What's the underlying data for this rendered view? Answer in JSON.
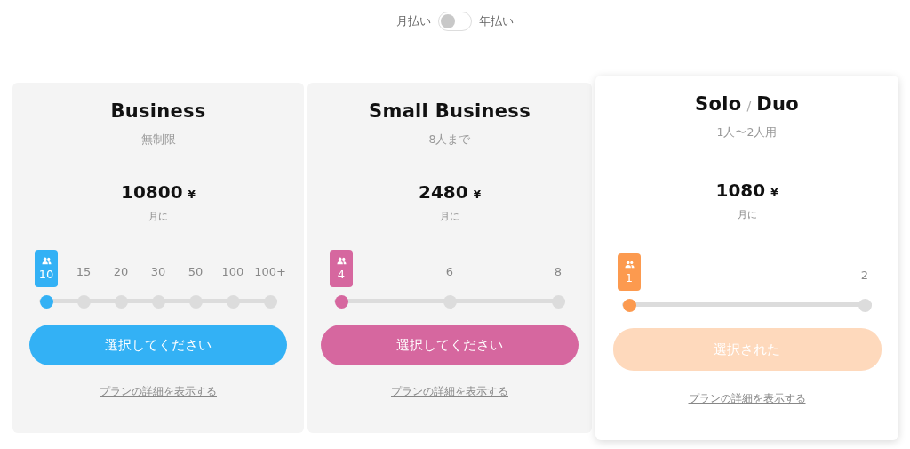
{
  "billing": {
    "monthly_label": "月払い",
    "annual_label": "年払い",
    "annual": false
  },
  "plans": [
    {
      "title_parts": [
        {
          "kind": "word",
          "text": "Business"
        }
      ],
      "subtitle": "無制限",
      "price": "10800",
      "currency": "¥",
      "period": "月に",
      "color": "#33b1f5",
      "selected": false,
      "steps": [
        {
          "label": "10",
          "selected": true
        },
        {
          "label": "15",
          "selected": false
        },
        {
          "label": "20",
          "selected": false
        },
        {
          "label": "30",
          "selected": false
        },
        {
          "label": "50",
          "selected": false
        },
        {
          "label": "100",
          "selected": false
        },
        {
          "label": "100+",
          "selected": false
        }
      ],
      "button": "選択してください",
      "details_link": "プランの詳細を表示する"
    },
    {
      "title_parts": [
        {
          "kind": "word",
          "text": "Small Business"
        }
      ],
      "subtitle": "8人まで",
      "price": "2480",
      "currency": "¥",
      "period": "月に",
      "color": "#d6679f",
      "selected": false,
      "steps": [
        {
          "label": "4",
          "selected": true
        },
        {
          "label": "6",
          "selected": false
        },
        {
          "label": "8",
          "selected": false
        }
      ],
      "button": "選択してください",
      "details_link": "プランの詳細を表示する"
    },
    {
      "title_parts": [
        {
          "kind": "word",
          "text": "Solo"
        },
        {
          "kind": "separator",
          "text": "/"
        },
        {
          "kind": "word",
          "text": "Duo"
        }
      ],
      "subtitle": "1人〜2人用",
      "price": "1080",
      "currency": "¥",
      "period": "月に",
      "color": "#fc9a4f",
      "selected": true,
      "steps": [
        {
          "label": "1",
          "selected": true
        },
        {
          "label": "2",
          "selected": false
        }
      ],
      "button": "選択された",
      "details_link": "プランの詳細を表示する"
    }
  ]
}
